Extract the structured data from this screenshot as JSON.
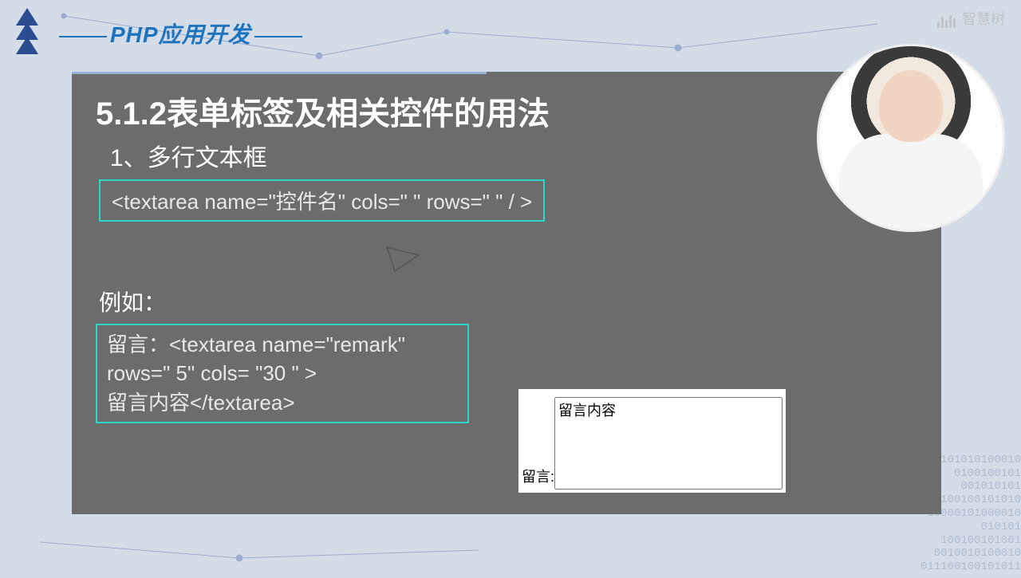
{
  "course_title": "PHP应用开发",
  "watermark": "智慧树",
  "slide": {
    "heading": "5.1.2表单标签及相关控件的用法",
    "subtitle": "1、多行文本框",
    "code1": "<textarea name=\"控件名\" cols=\" \"  rows=\" \"  / >",
    "example_label": "例如：",
    "code2_line1": "留言：<textarea name=\"remark\"",
    "code2_line2": " rows=\" 5\"  cols= \"30 \"  >",
    "code2_line3": "留言内容</textarea>"
  },
  "render": {
    "label": "留言:",
    "textarea_content": "留言内容"
  },
  "binary": "101010100010\n0100100101\n001010101\n100100101010\n10000101000010\n010101\n100100101001\n0010010100010\n011100100101011"
}
